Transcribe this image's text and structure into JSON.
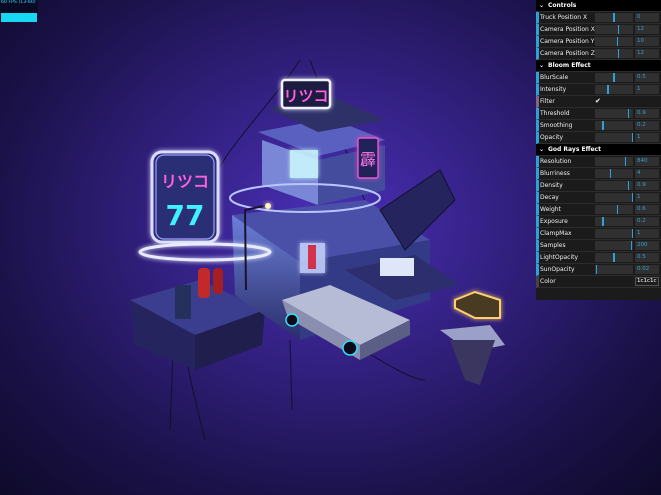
{
  "fps": {
    "label": "60 FPS (13-60)"
  },
  "scene": {
    "sign_left": "リツコ",
    "sign_left_number": "77",
    "sign_top": "リツコ",
    "sign_vertical": "霹"
  },
  "gui": {
    "folders": [
      {
        "title": "Controls",
        "rows": [
          {
            "label": "Truck Position X",
            "type": "slider",
            "value": "0",
            "fraction": 0.5
          },
          {
            "label": "Camera Position X",
            "type": "slider",
            "value": "12",
            "fraction": 0.62
          },
          {
            "label": "Camera Position Y",
            "type": "slider",
            "value": "10",
            "fraction": 0.6
          },
          {
            "label": "Camera Position Z",
            "type": "slider",
            "value": "12",
            "fraction": 0.62
          }
        ]
      },
      {
        "title": "Bloom Effect",
        "rows": [
          {
            "label": "BlurScale",
            "type": "slider",
            "value": "0.5",
            "fraction": 0.5
          },
          {
            "label": "Intensity",
            "type": "slider",
            "value": "1",
            "fraction": 0.33
          },
          {
            "label": "Filter",
            "type": "checkbox",
            "checked": true
          },
          {
            "label": "Threshold",
            "type": "slider",
            "value": "0.9",
            "fraction": 0.9
          },
          {
            "label": "Smoothing",
            "type": "slider",
            "value": "0.2",
            "fraction": 0.2
          },
          {
            "label": "Opacity",
            "type": "slider",
            "value": "1",
            "fraction": 1.0
          }
        ]
      },
      {
        "title": "God Rays Effect",
        "rows": [
          {
            "label": "Resolution",
            "type": "slider",
            "value": "840",
            "fraction": 0.82
          },
          {
            "label": "Blurriness",
            "type": "slider",
            "value": "4",
            "fraction": 0.4
          },
          {
            "label": "Density",
            "type": "slider",
            "value": "0.9",
            "fraction": 0.9
          },
          {
            "label": "Decay",
            "type": "slider",
            "value": "1",
            "fraction": 1.0
          },
          {
            "label": "Weight",
            "type": "slider",
            "value": "0.6",
            "fraction": 0.6
          },
          {
            "label": "Exposure",
            "type": "slider",
            "value": "0.2",
            "fraction": 0.2
          },
          {
            "label": "ClampMax",
            "type": "slider",
            "value": "1",
            "fraction": 1.0
          },
          {
            "label": "Samples",
            "type": "slider",
            "value": "200",
            "fraction": 0.98
          },
          {
            "label": "LightOpacity",
            "type": "slider",
            "value": "0.5",
            "fraction": 0.5
          },
          {
            "label": "SunOpacity",
            "type": "slider",
            "value": "0.02",
            "fraction": 0.02
          },
          {
            "label": "Color",
            "type": "color",
            "value": "1c1c1c",
            "hex": "#1c1c1c"
          }
        ]
      }
    ]
  },
  "colors": {
    "accent": "#2fa1d6",
    "fps_bar": "#17d7f2",
    "neon_pink": "#ff4fd8",
    "neon_cyan": "#3ff0ff"
  }
}
